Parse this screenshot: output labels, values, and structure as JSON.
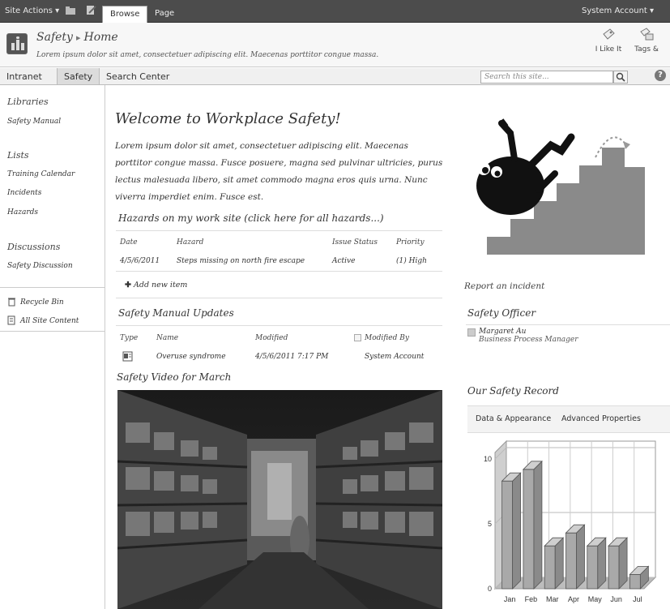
{
  "ribbon": {
    "site_actions": "Site Actions",
    "tabs": [
      "Browse",
      "Page"
    ],
    "user": "System Account"
  },
  "title": {
    "site": "Safety",
    "page": "Home",
    "description": "Lorem ipsum dolor sit amet, consectetuer adipiscing elit. Maecenas porttitor congue massa.",
    "like": "I Like It",
    "tags": "Tags &"
  },
  "topnav": {
    "items": [
      "Intranet",
      "Safety",
      "Search Center"
    ],
    "search_placeholder": "Search this site..."
  },
  "leftnav": {
    "libraries_heading": "Libraries",
    "libraries": [
      "Safety Manual"
    ],
    "lists_heading": "Lists",
    "lists": [
      "Training Calendar",
      "Incidents",
      "Hazards"
    ],
    "discussions_heading": "Discussions",
    "discussions": [
      "Safety Discussion"
    ],
    "recycle": "Recycle Bin",
    "all_content": "All Site Content"
  },
  "main": {
    "welcome": "Welcome to Workplace Safety!",
    "intro": "Lorem ipsum dolor sit amet, consectetuer adipiscing elit. Maecenas porttitor congue massa. Fusce posuere, magna sed pulvinar ultricies, purus lectus malesuada libero, sit amet commodo magna eros quis urna. Nunc viverra imperdiet enim. Fusce est.",
    "hazards": {
      "title": "Hazards on my work site (click here for all hazards...)",
      "columns": [
        "Date",
        "Hazard",
        "Issue Status",
        "Priority"
      ],
      "rows": [
        {
          "date": "4/5/6/2011",
          "hazard": "Steps missing on north fire escape",
          "status": "Active",
          "priority": "(1) High"
        }
      ],
      "add_new": "Add new item"
    },
    "manual": {
      "title": "Safety Manual Updates",
      "columns": [
        "Type",
        "Name",
        "Modified",
        "Modified By"
      ],
      "rows": [
        {
          "name": "Overuse syndrome",
          "modified": "4/5/6/2011 7:17 PM",
          "modified_by": "System Account"
        }
      ]
    },
    "video_title": "Safety Video for March"
  },
  "right": {
    "report_link": "Report an incident",
    "officer_title": "Safety Officer",
    "officer_name": "Margaret Au",
    "officer_role": "Business Process Manager",
    "record_title": "Our Safety Record",
    "chart_tabs": [
      "Data & Appearance",
      "Advanced Properties"
    ]
  },
  "chart_data": {
    "type": "bar",
    "categories": [
      "Jan",
      "Feb",
      "Mar",
      "Apr",
      "May",
      "Jun",
      "Jul"
    ],
    "values": [
      8.3,
      9.2,
      3.3,
      4.3,
      3.3,
      3.3,
      1.1
    ],
    "yticks": [
      "10",
      "5",
      "0"
    ],
    "ylim": [
      0,
      10.5
    ],
    "grid": true,
    "style": "3d"
  }
}
